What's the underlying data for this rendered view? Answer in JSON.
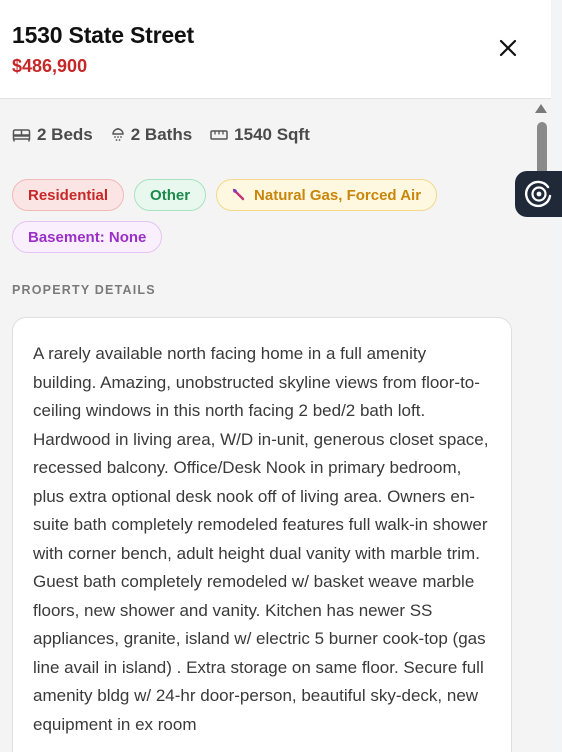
{
  "header": {
    "title": "1530 State Street",
    "price": "$486,900"
  },
  "specs": {
    "beds": "2 Beds",
    "baths": "2 Baths",
    "sqft": "1540 Sqft"
  },
  "chips": {
    "type": "Residential",
    "style": "Other",
    "heating": "Natural Gas, Forced Air",
    "basement": "Basement: None"
  },
  "details": {
    "label": "PROPERTY DETAILS",
    "description": "A rarely available north facing home in a full amenity building. Amazing, unobstructed skyline views from floor-to-ceiling windows in this north facing 2 bed/2 bath loft. Hardwood in living area, W/D in-unit, generous closet space, recessed balcony. Office/Desk Nook in primary bedroom, plus extra optional desk nook off of living area. Owners en-suite bath completely remodeled features full walk-in shower with corner bench, adult height dual vanity with marble trim. Guest bath completely remodeled w/ basket weave marble floors, new shower and vanity. Kitchen has newer SS appliances, granite, island w/ electric 5 burner cook-top (gas line avail in island) . Extra storage on same floor. Secure full amenity bldg w/ 24-hr door-person, beautiful sky-deck, new equipment in ex room"
  },
  "colors": {
    "price": "#c62828",
    "fab_bg": "#1f2937"
  },
  "icons": {
    "close": "close-icon",
    "beds": "bed-icon",
    "baths": "shower-icon",
    "sqft": "ruler-icon",
    "heating": "flame-icon",
    "fab": "target-icon"
  }
}
